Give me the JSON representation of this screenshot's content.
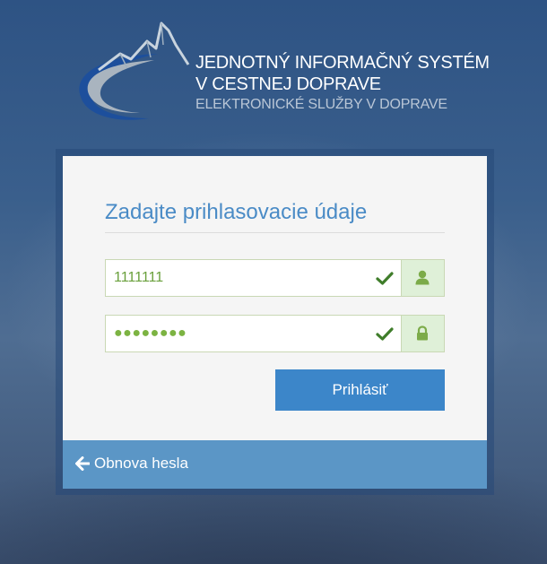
{
  "header": {
    "logo_line1": "JEDNOTNÝ INFORMAČNÝ SYSTÉM",
    "logo_line2": "V CESTNEJ DOPRAVE",
    "logo_line3": "ELEKTRONICKÉ SLUŽBY V DOPRAVE"
  },
  "login": {
    "title": "Zadajte prihlasovacie údaje",
    "username_value": "1111111",
    "password_masked": "●●●●●●●●",
    "submit_label": "Prihlásiť",
    "username_icon": "user-icon",
    "password_icon": "lock-icon",
    "valid_icon": "checkmark-icon"
  },
  "footer": {
    "reset_label": "Obnova hesla",
    "reset_icon": "arrow-left-icon"
  },
  "colors": {
    "accent_blue": "#4a8bc6",
    "button_blue": "#3c86c9",
    "footer_blue": "#5b96c6",
    "success_green": "#7cb342",
    "addon_green_bg": "#dff0d8"
  }
}
